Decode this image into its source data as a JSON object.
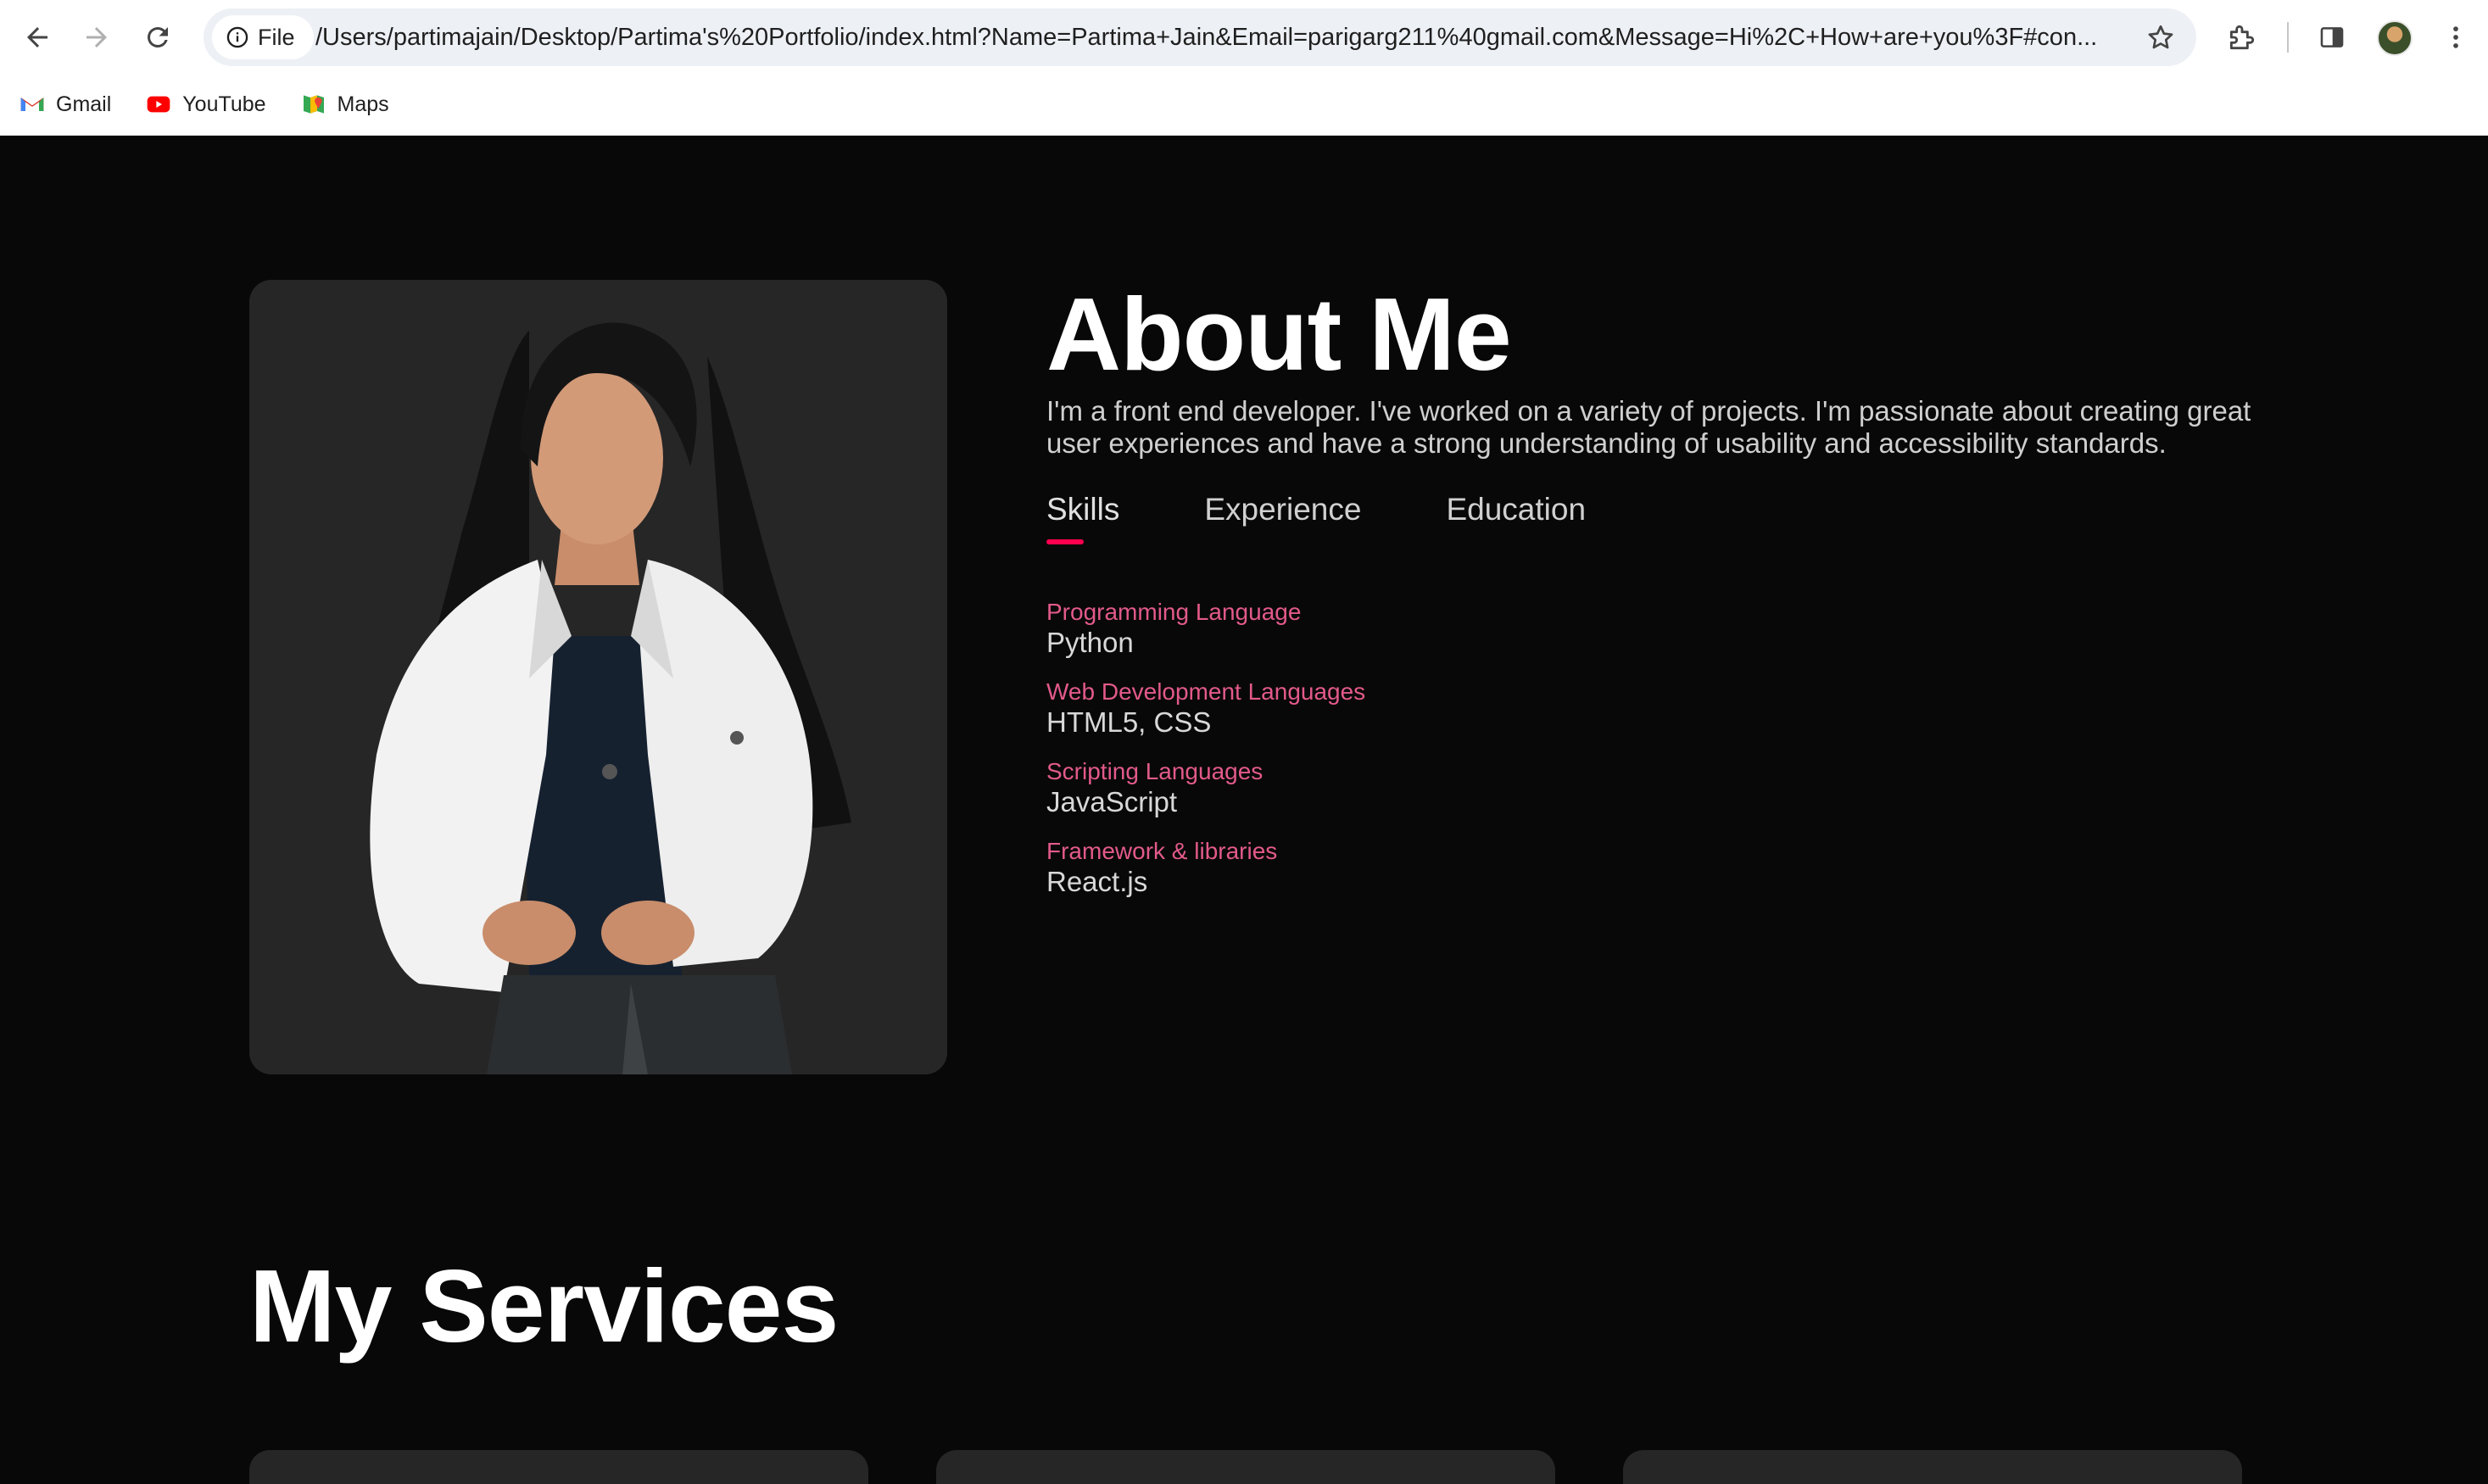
{
  "browser": {
    "site_info_label": "File",
    "url": "/Users/partimajain/Desktop/Partima's%20Portfolio/index.html?Name=Partima+Jain&Email=parigarg211%40gmail.com&Message=Hi%2C+How+are+you%3F#con...",
    "bookmarks": [
      {
        "label": "Gmail",
        "icon": "gmail-icon"
      },
      {
        "label": "YouTube",
        "icon": "youtube-icon"
      },
      {
        "label": "Maps",
        "icon": "maps-icon"
      }
    ]
  },
  "about": {
    "title": "About Me",
    "text": "I'm a front end developer. I've worked on a variety of projects. I'm passionate about creating great user experiences and have a strong understanding of usability and accessibility standards.",
    "tabs": [
      {
        "label": "Skills",
        "active": true
      },
      {
        "label": "Experience",
        "active": false
      },
      {
        "label": "Education",
        "active": false
      }
    ],
    "skills": [
      {
        "category": "Programming Language",
        "value": "Python"
      },
      {
        "category": "Web Development Languages",
        "value": "HTML5, CSS"
      },
      {
        "category": "Scripting Languages",
        "value": "JavaScript"
      },
      {
        "category": "Framework & libraries",
        "value": "React.js"
      }
    ]
  },
  "services": {
    "title": "My Services"
  },
  "colors": {
    "accent": "#ff004f",
    "skill_category": "#e25a8a",
    "background": "#080808",
    "card": "#262626"
  }
}
